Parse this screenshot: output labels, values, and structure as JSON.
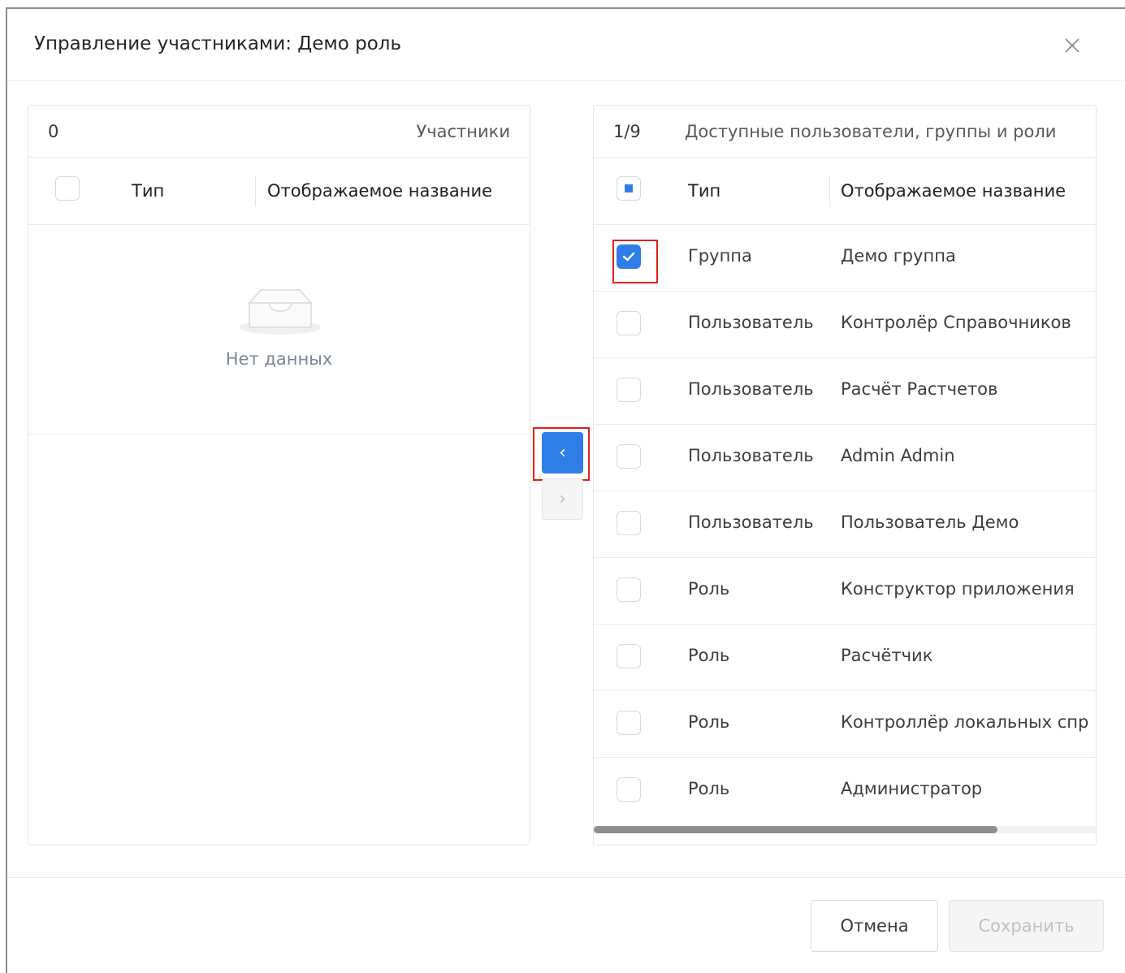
{
  "modal": {
    "title": "Управление участниками: Демо роль"
  },
  "left_panel": {
    "count": "0",
    "title": "Участники",
    "columns": {
      "type": "Тип",
      "name": "Отображаемое название"
    },
    "empty_text": "Нет данных"
  },
  "right_panel": {
    "count": "1/9",
    "title": "Доступные пользователи, группы и роли",
    "columns": {
      "type": "Тип",
      "name": "Отображаемое название"
    },
    "rows": [
      {
        "type": "Группа",
        "name": "Демо группа",
        "checked": true
      },
      {
        "type": "Пользователь",
        "name": "Контролёр Справочников",
        "checked": false
      },
      {
        "type": "Пользователь",
        "name": "Расчёт Растчетов",
        "checked": false
      },
      {
        "type": "Пользователь",
        "name": "Admin Admin",
        "checked": false
      },
      {
        "type": "Пользователь",
        "name": "Пользователь Демо",
        "checked": false
      },
      {
        "type": "Роль",
        "name": "Конструктор приложения",
        "checked": false
      },
      {
        "type": "Роль",
        "name": "Расчётчик",
        "checked": false
      },
      {
        "type": "Роль",
        "name": "Контроллёр локальных спр",
        "checked": false
      },
      {
        "type": "Роль",
        "name": "Администратор",
        "checked": false
      }
    ]
  },
  "transfer": {
    "left_arrow": "‹",
    "right_arrow": "›"
  },
  "footer": {
    "cancel_label": "Отмена",
    "save_label": "Сохранить"
  },
  "colors": {
    "accent": "#2f7ee8",
    "highlight": "#e0201b"
  }
}
